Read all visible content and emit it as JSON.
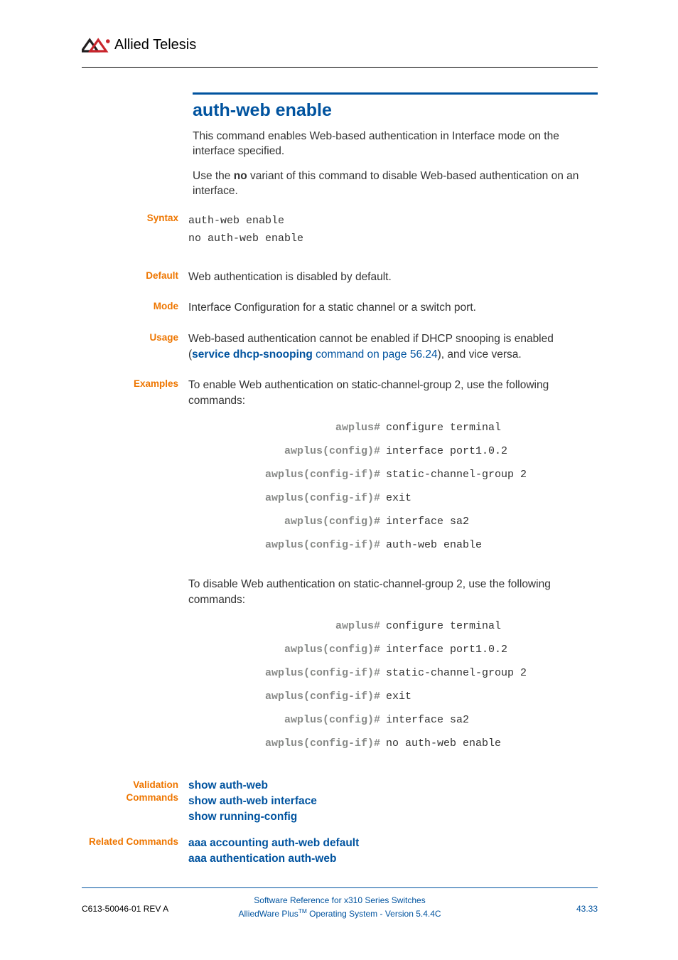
{
  "logo_text": "Allied Telesis",
  "title": "auth-web enable",
  "intro_1a": "This command enables Web-based authentication in Interface mode on the interface specified.",
  "intro_2a": "Use the ",
  "intro_2b": "no",
  "intro_2c": " variant of this command to disable Web-based authentication on an interface.",
  "labels": {
    "syntax": "Syntax",
    "default": "Default",
    "mode": "Mode",
    "usage": "Usage",
    "examples": "Examples",
    "validation": "Validation Commands",
    "related": "Related Commands"
  },
  "syntax": {
    "l1": "auth-web enable",
    "l2": "no auth-web enable"
  },
  "default_text": "Web authentication is disabled by default.",
  "mode_text": "Interface Configuration for a static channel or a switch port.",
  "usage": {
    "t1": "Web-based authentication cannot be enabled if DHCP snooping is enabled (",
    "link1": "service dhcp-snooping",
    "link1_suffix": " command on page 56.24",
    "t2": "), and vice versa."
  },
  "examples": {
    "intro1": "To enable Web authentication on static-channel-group 2, use the following commands:",
    "cmds1": [
      {
        "prompt": "awplus#",
        "cmd": "configure terminal"
      },
      {
        "prompt": "awplus(config)#",
        "cmd": "interface port1.0.2"
      },
      {
        "prompt": "awplus(config-if)#",
        "cmd": "static-channel-group 2"
      },
      {
        "prompt": "awplus(config-if)#",
        "cmd": "exit"
      },
      {
        "prompt": "awplus(config)#",
        "cmd": "interface sa2"
      },
      {
        "prompt": "awplus(config-if)#",
        "cmd": "auth-web enable"
      }
    ],
    "intro2": "To disable Web authentication on static-channel-group 2, use the following commands:",
    "cmds2": [
      {
        "prompt": "awplus#",
        "cmd": "configure terminal"
      },
      {
        "prompt": "awplus(config)#",
        "cmd": "interface port1.0.2"
      },
      {
        "prompt": "awplus(config-if)#",
        "cmd": "static-channel-group 2"
      },
      {
        "prompt": "awplus(config-if)#",
        "cmd": "exit"
      },
      {
        "prompt": "awplus(config)#",
        "cmd": "interface sa2"
      },
      {
        "prompt": "awplus(config-if)#",
        "cmd": "no auth-web enable"
      }
    ]
  },
  "validation_links": {
    "l1": "show auth-web",
    "l2": "show auth-web interface",
    "l3": "show running-config"
  },
  "related_links": {
    "l1": "aaa accounting auth-web default",
    "l2": "aaa authentication auth-web"
  },
  "footer": {
    "left": "C613-50046-01 REV A",
    "center1": "Software Reference for x310 Series Switches",
    "center2a": "AlliedWare Plus",
    "center2b": "TM",
    "center2c": " Operating System - Version 5.4.4C",
    "right": "43.33"
  }
}
